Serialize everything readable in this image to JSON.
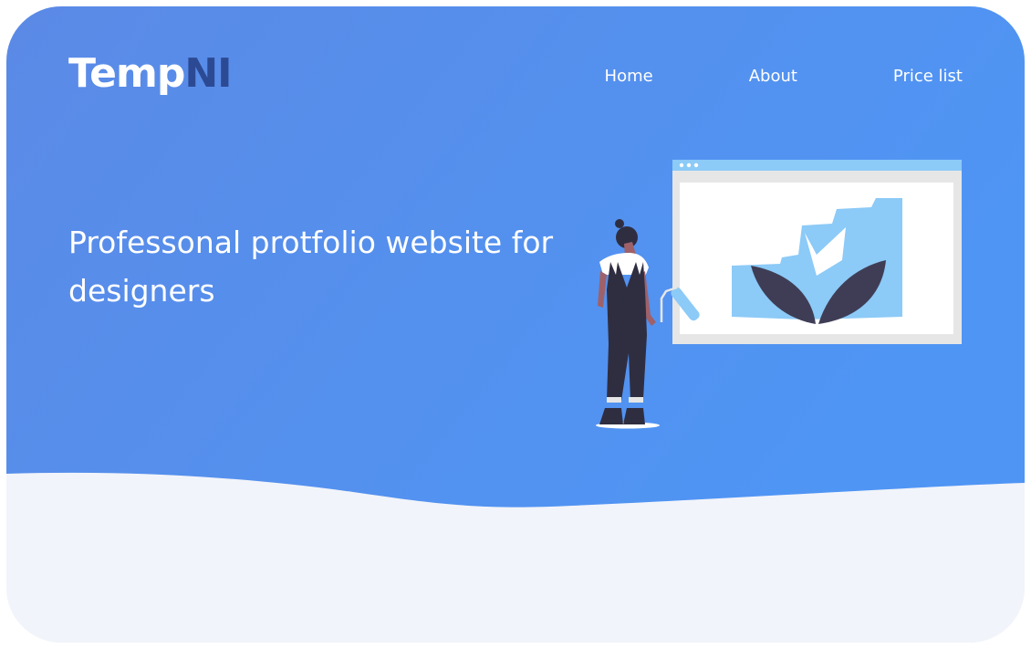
{
  "brand": {
    "name_part1": "Temp",
    "name_part2": "NI"
  },
  "nav": {
    "items": [
      {
        "label": "Home"
      },
      {
        "label": "About"
      },
      {
        "label": "Price list"
      }
    ]
  },
  "hero": {
    "headline": "Professonal protfolio website for designers"
  },
  "illustration": {
    "name": "painter-with-browser-illustration"
  },
  "colors": {
    "hero_gradient_start": "#5b8ae6",
    "hero_gradient_end": "#4f95f4",
    "wave_fill": "#f1f4fa",
    "logo_accent": "#2c4a93",
    "light_blue": "#8ccaf7",
    "dark": "#3f3d56"
  }
}
